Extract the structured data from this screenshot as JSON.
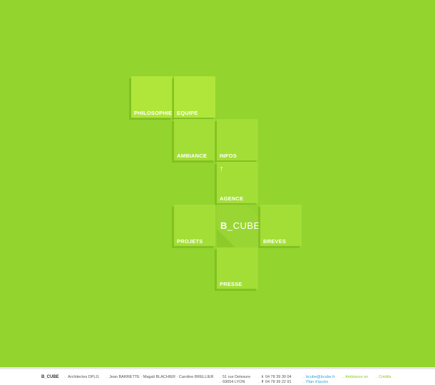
{
  "tiles": {
    "philosophie": "PHILOSOPHIE",
    "equipe": "EQUIPE",
    "ambiance": "AMBIANCE",
    "infos": "INFOS",
    "agence": "AGENCE",
    "agence_arrow": "↑",
    "projets": "PROJETS",
    "breves": "BREVES",
    "presse": "PRESSE"
  },
  "logo": {
    "bold": "B",
    "rest": "_CUBE"
  },
  "footer": {
    "brand": "B_CUBE",
    "sep": "..",
    "title": "Architectes DPLG",
    "people": "Jean BARRETTE · Magali BLACHIER · Caroline BRELLIER",
    "address_line1": "51 rue Delesure",
    "address_line2": "69004 LYON",
    "phone_prefix": "t",
    "phone": "04 78 39 30 04",
    "fax_prefix": "f",
    "fax": "04 78 39 22 91",
    "email": "bcube@bcube.fr",
    "map": "Plan d'accès",
    "ambiance_on": "Ambiance on",
    "credits": "Crédits"
  },
  "colors": {
    "background": "#93d42f",
    "tile": "#a3de36",
    "footer_link_blue": "#2aa4d8",
    "footer_link_green": "#8cc920"
  }
}
